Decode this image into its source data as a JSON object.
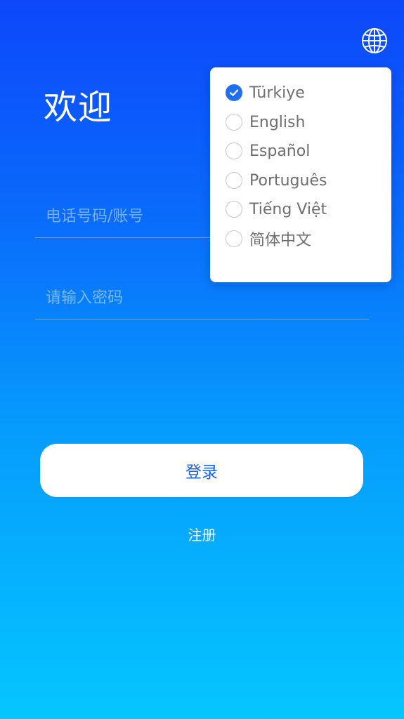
{
  "header": {
    "globe_icon": "globe-icon"
  },
  "welcome": {
    "title": "欢迎"
  },
  "form": {
    "phone_placeholder": "电话号码/账号",
    "phone_value": "",
    "password_placeholder": "请输入密码",
    "password_value": ""
  },
  "actions": {
    "login_label": "登录",
    "register_label": "注册"
  },
  "language_menu": {
    "selected": "Türkiye",
    "items": [
      {
        "label": "Türkiye",
        "checked": true
      },
      {
        "label": "English",
        "checked": false
      },
      {
        "label": "Español",
        "checked": false
      },
      {
        "label": "Português",
        "checked": false
      },
      {
        "label": "Tiếng Việt",
        "checked": false
      },
      {
        "label": "简体中文",
        "checked": false
      }
    ]
  },
  "colors": {
    "gradient_top": "#0d47fb",
    "gradient_bottom": "#05c6fe",
    "accent": "#1f6ff2",
    "button_text": "#1d64e8"
  }
}
